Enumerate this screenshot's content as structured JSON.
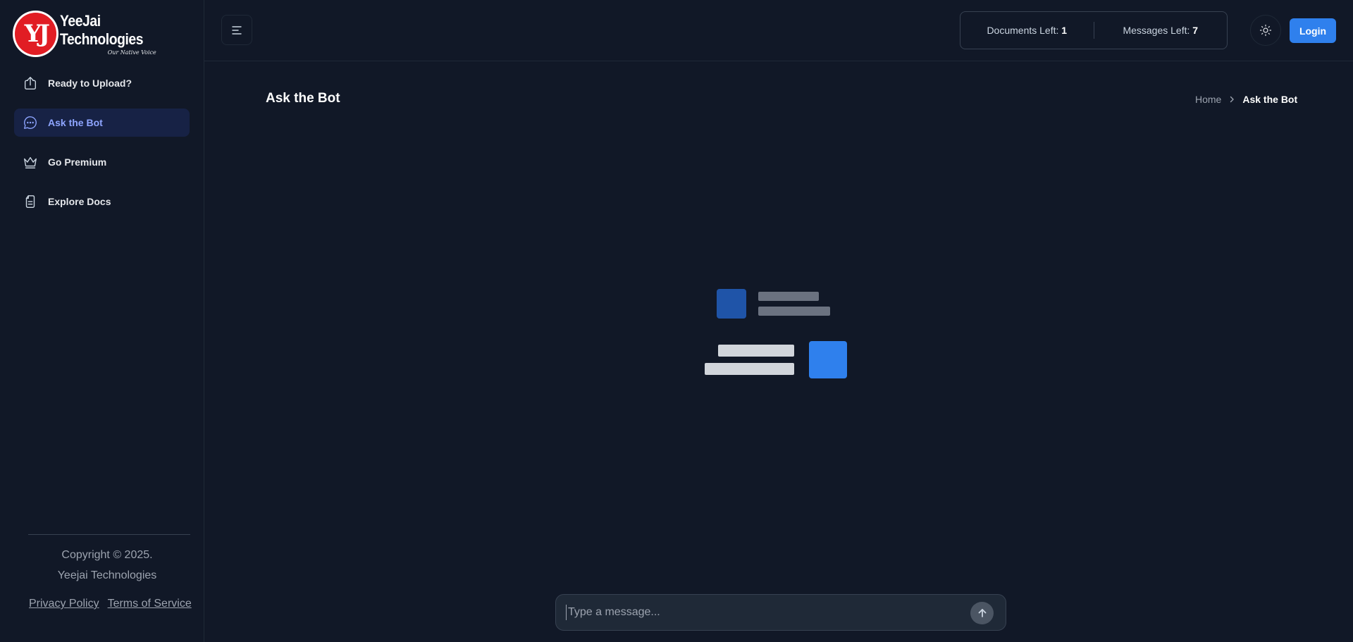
{
  "brand": {
    "name": "YeeJai Technologies",
    "tagline": "Our Native Voice",
    "mark": "YJ"
  },
  "sidebar": {
    "items": [
      {
        "label": "Ready to Upload?",
        "icon": "upload-icon",
        "active": false
      },
      {
        "label": "Ask the Bot",
        "icon": "chat-bubble-icon",
        "active": true
      },
      {
        "label": "Go Premium",
        "icon": "crown-icon",
        "active": false
      },
      {
        "label": "Explore Docs",
        "icon": "document-icon",
        "active": false
      }
    ],
    "copyright_line1": "Copyright © 2025.",
    "copyright_line2": "Yeejai Technologies",
    "privacy_label": "Privacy Policy",
    "terms_label": "Terms of Service"
  },
  "header": {
    "documents_label": "Documents Left:",
    "documents_value": "1",
    "messages_label": "Messages Left:",
    "messages_value": "7",
    "login_label": "Login"
  },
  "main": {
    "title": "Ask the Bot",
    "breadcrumb_home": "Home",
    "breadcrumb_current": "Ask the Bot"
  },
  "chat": {
    "placeholder": "Type a message..."
  },
  "colors": {
    "background": "#111827",
    "accent": "#2f80ed",
    "active_nav_bg": "#172245",
    "active_nav_text": "#8ea5ff"
  }
}
